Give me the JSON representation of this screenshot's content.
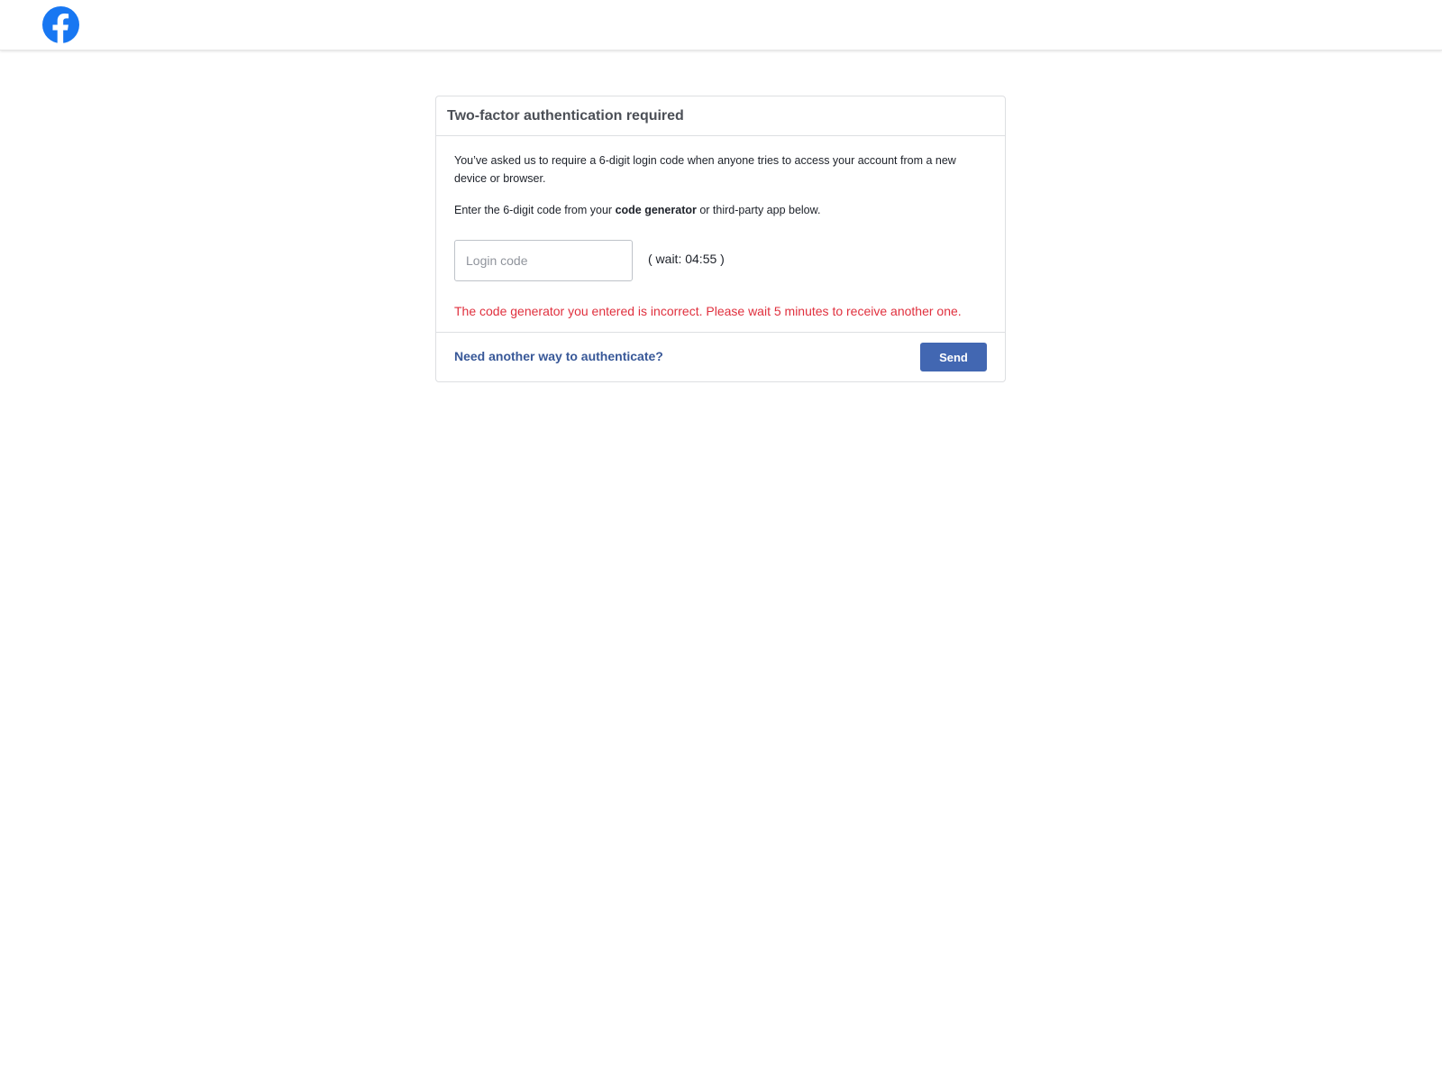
{
  "header": {
    "logo_icon": "facebook-logo-icon",
    "brand_color": "#1877f2"
  },
  "card": {
    "title": "Two-factor authentication required",
    "description": "You’ve asked us to require a 6-digit login code when anyone tries to access your account from a new device or browser.",
    "instruction_prefix": "Enter the 6-digit code from your ",
    "instruction_bold": "code generator",
    "instruction_suffix": " or third-party app below.",
    "login_code": {
      "placeholder": "Login code",
      "value": ""
    },
    "wait_text": "( wait: 04:55 )",
    "error_message": "The code generator you entered is incorrect. Please wait 5 minutes to receive another one.",
    "error_color": "#e0303e",
    "alt_auth_link": "Need another way to authenticate?",
    "send_label": "Send",
    "button_color": "#4267b2",
    "link_color": "#385898"
  }
}
